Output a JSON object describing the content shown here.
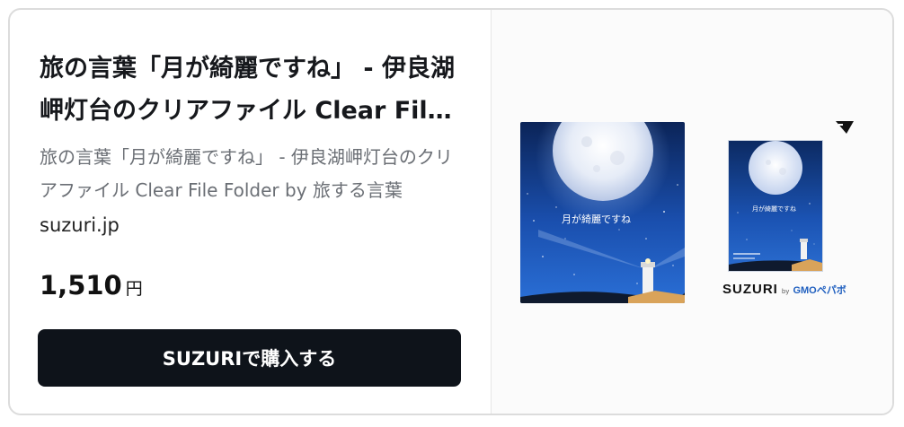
{
  "card": {
    "title": "旅の言葉「月が綺麗ですね」 - 伊良湖岬灯台のクリアファイル Clear File Folder by 旅する言葉",
    "description": "旅の言葉「月が綺麗ですね」 - 伊良湖岬灯台のクリアファイル Clear File Folder by 旅する言葉",
    "domain": "suzuri.jp",
    "price": "1,510",
    "currency": "円",
    "buy_label": "SUZURIで購入する"
  },
  "image": {
    "folder_text": "月が綺麗ですね",
    "brand": "SUZURI",
    "brand_by": "by",
    "brand_partner": "GMOペパボ"
  },
  "colors": {
    "button": "#0e131a",
    "sky_top": "#0d2b6b",
    "sky_bottom": "#1d57b8"
  }
}
